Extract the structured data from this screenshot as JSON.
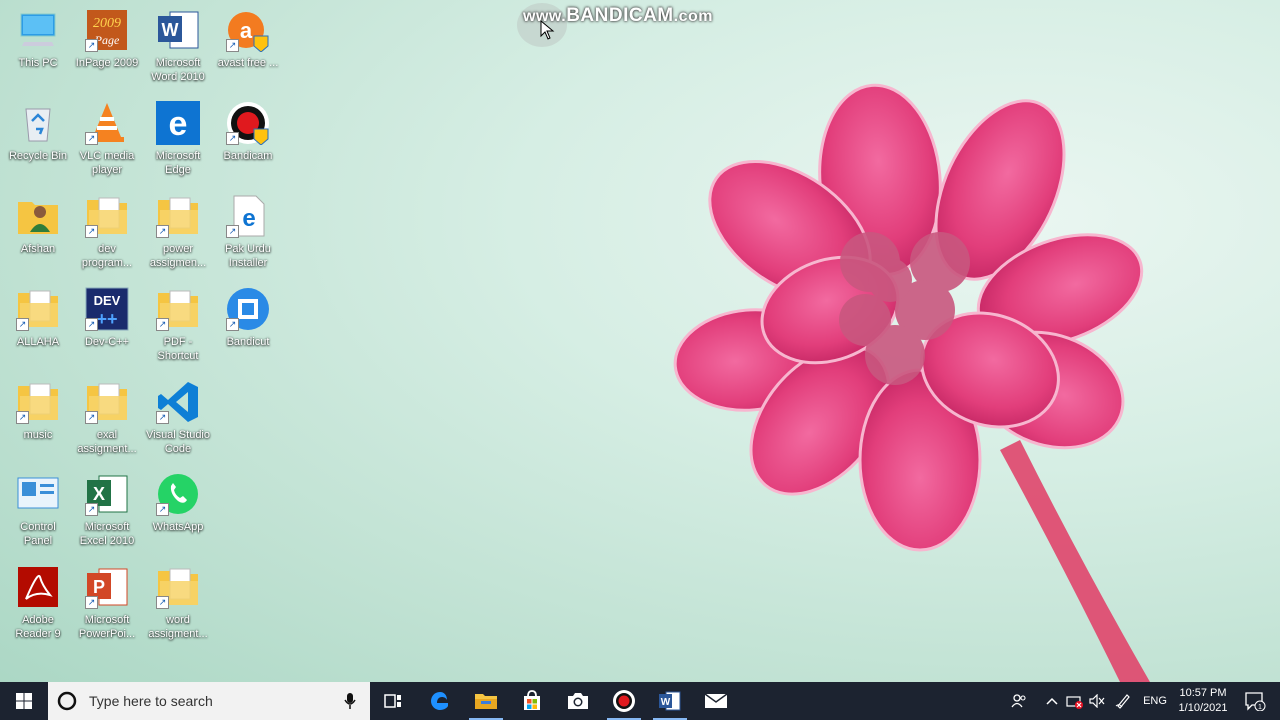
{
  "watermark": {
    "prefix": "www.",
    "brand": "BANDICAM",
    "suffix": ".com"
  },
  "desktop": {
    "icons": [
      {
        "label": "This PC",
        "icon": "this-pc-icon"
      },
      {
        "label": "InPage 2009",
        "icon": "inpage-icon"
      },
      {
        "label": "Microsoft\nWord 2010",
        "icon": "word-icon"
      },
      {
        "label": "avast free ...",
        "icon": "avast-icon"
      },
      {
        "label": "Recycle Bin",
        "icon": "recycle-bin-icon"
      },
      {
        "label": "VLC media\nplayer",
        "icon": "vlc-icon"
      },
      {
        "label": "Microsoft\nEdge",
        "icon": "edge-icon"
      },
      {
        "label": "Bandicam",
        "icon": "bandicam-icon"
      },
      {
        "label": "Afshan",
        "icon": "user-folder-icon"
      },
      {
        "label": "dev\nprogram...",
        "icon": "folder-icon"
      },
      {
        "label": "power\nassigmen...",
        "icon": "folder-icon"
      },
      {
        "label": "Pak Urdu\nInstaller",
        "icon": "edge-file-icon"
      },
      {
        "label": "ALLAHA",
        "icon": "folder-icon"
      },
      {
        "label": "Dev-C++",
        "icon": "devcpp-icon"
      },
      {
        "label": "PDF -\nShortcut",
        "icon": "folder-icon"
      },
      {
        "label": "Bandicut",
        "icon": "bandicut-icon"
      },
      {
        "label": "music",
        "icon": "folder-icon"
      },
      {
        "label": "exal\nassigment...",
        "icon": "folder-icon"
      },
      {
        "label": "Visual Studio\nCode",
        "icon": "vscode-icon"
      },
      {
        "label": "Control\nPanel",
        "icon": "control-panel-icon"
      },
      {
        "label": "Microsoft\nExcel 2010",
        "icon": "excel-icon"
      },
      {
        "label": "WhatsApp",
        "icon": "whatsapp-icon"
      },
      {
        "label": "Adobe\nReader 9",
        "icon": "adobe-reader-icon"
      },
      {
        "label": "Microsoft\nPowerPoi...",
        "icon": "powerpoint-icon"
      },
      {
        "label": "word\nassigment...",
        "icon": "folder-icon"
      }
    ]
  },
  "taskbar": {
    "search_placeholder": "Type here to search",
    "apps": [
      "task-view-icon",
      "edge-icon",
      "file-explorer-icon",
      "store-icon",
      "camera-icon",
      "bandicam-icon",
      "word-icon",
      "mail-icon"
    ],
    "tray": {
      "language": "ENG",
      "time": "10:57 PM",
      "date": "1/10/2021",
      "notifications": "1"
    }
  },
  "colors": {
    "taskbar": "#1c2330",
    "accent": "#86b8f3",
    "flower": "#e8447f"
  }
}
